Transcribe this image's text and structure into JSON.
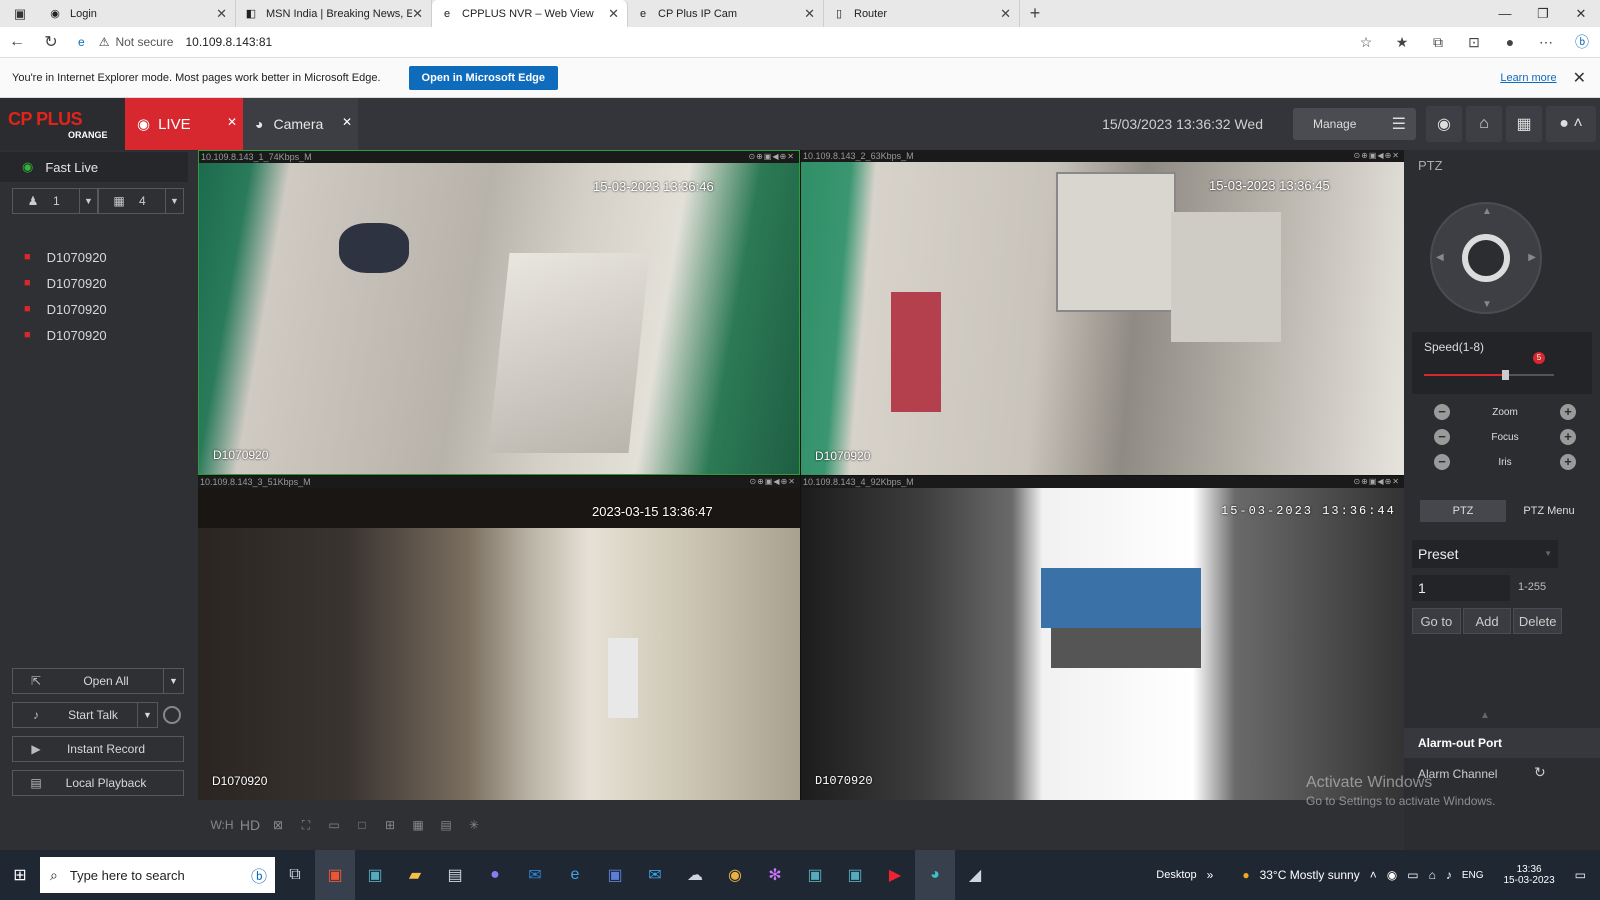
{
  "browser": {
    "tabs": [
      {
        "title": "Login",
        "icon": "globe-icon"
      },
      {
        "title": "MSN India | Breaking News, Ente",
        "icon": "msn-icon"
      },
      {
        "title": "CPPLUS NVR – Web View",
        "icon": "ie-icon",
        "active": true
      },
      {
        "title": "CP Plus IP Cam",
        "icon": "ie-icon"
      },
      {
        "title": "Router",
        "icon": "page-icon"
      }
    ],
    "not_secure": "Not secure",
    "url": "10.109.8.143:81",
    "ie_message": "You're in Internet Explorer mode. Most pages work better in Microsoft Edge.",
    "open_edge": "Open in Microsoft Edge",
    "learn_more": "Learn more"
  },
  "nvr": {
    "logo_main": "CP PLUS",
    "logo_sub": "ORANGE",
    "live_tab": "LIVE",
    "camera_tab": "Camera",
    "datetime": "15/03/2023 13:36:32 Wed",
    "manage": "Manage"
  },
  "sidebar": {
    "fast_live": "Fast Live",
    "sel1_value": "1",
    "sel2_value": "4",
    "devices": [
      "D1070920",
      "D1070920",
      "D1070920",
      "D1070920"
    ],
    "buttons": {
      "open_all": "Open All",
      "start_talk": "Start Talk",
      "instant_record": "Instant Record",
      "local_playback": "Local Playback"
    }
  },
  "cameras": [
    {
      "header": "10.109.8.143_1_74Kbps_M",
      "timestamp": "15-03-2023 13:36:46",
      "name": "D1070920"
    },
    {
      "header": "10.109.8.143_2_63Kbps_M",
      "timestamp": "15-03-2023 13:36:45",
      "name": "D1070920"
    },
    {
      "header": "10.109.8.143_3_51Kbps_M",
      "timestamp": "2023-03-15 13:36:47",
      "name": "D1070920"
    },
    {
      "header": "10.109.8.143_4_92Kbps_M",
      "timestamp": "15-03-2023  13:36:44",
      "name": "D1070920"
    }
  ],
  "ptz": {
    "label": "PTZ",
    "speed_label": "Speed(1-8)",
    "speed_value": "5",
    "speed_fraction": 0.62,
    "zoom": "Zoom",
    "focus": "Focus",
    "iris": "Iris",
    "tab_ptz": "PTZ",
    "tab_menu": "PTZ Menu",
    "preset": "Preset",
    "preset_num": "1",
    "preset_range": "1-255",
    "goto": "Go to",
    "add": "Add",
    "delete": "Delete",
    "alarm_out": "Alarm-out Port",
    "alarm_channel": "Alarm Channel"
  },
  "watermark": {
    "line1": "Activate Windows",
    "line2": "Go to Settings to activate Windows."
  },
  "taskbar": {
    "search_placeholder": "Type here to search",
    "desktop": "Desktop",
    "weather": "33°C  Mostly sunny",
    "lang": "ENG",
    "time": "13:36",
    "date": "15-03-2023"
  }
}
